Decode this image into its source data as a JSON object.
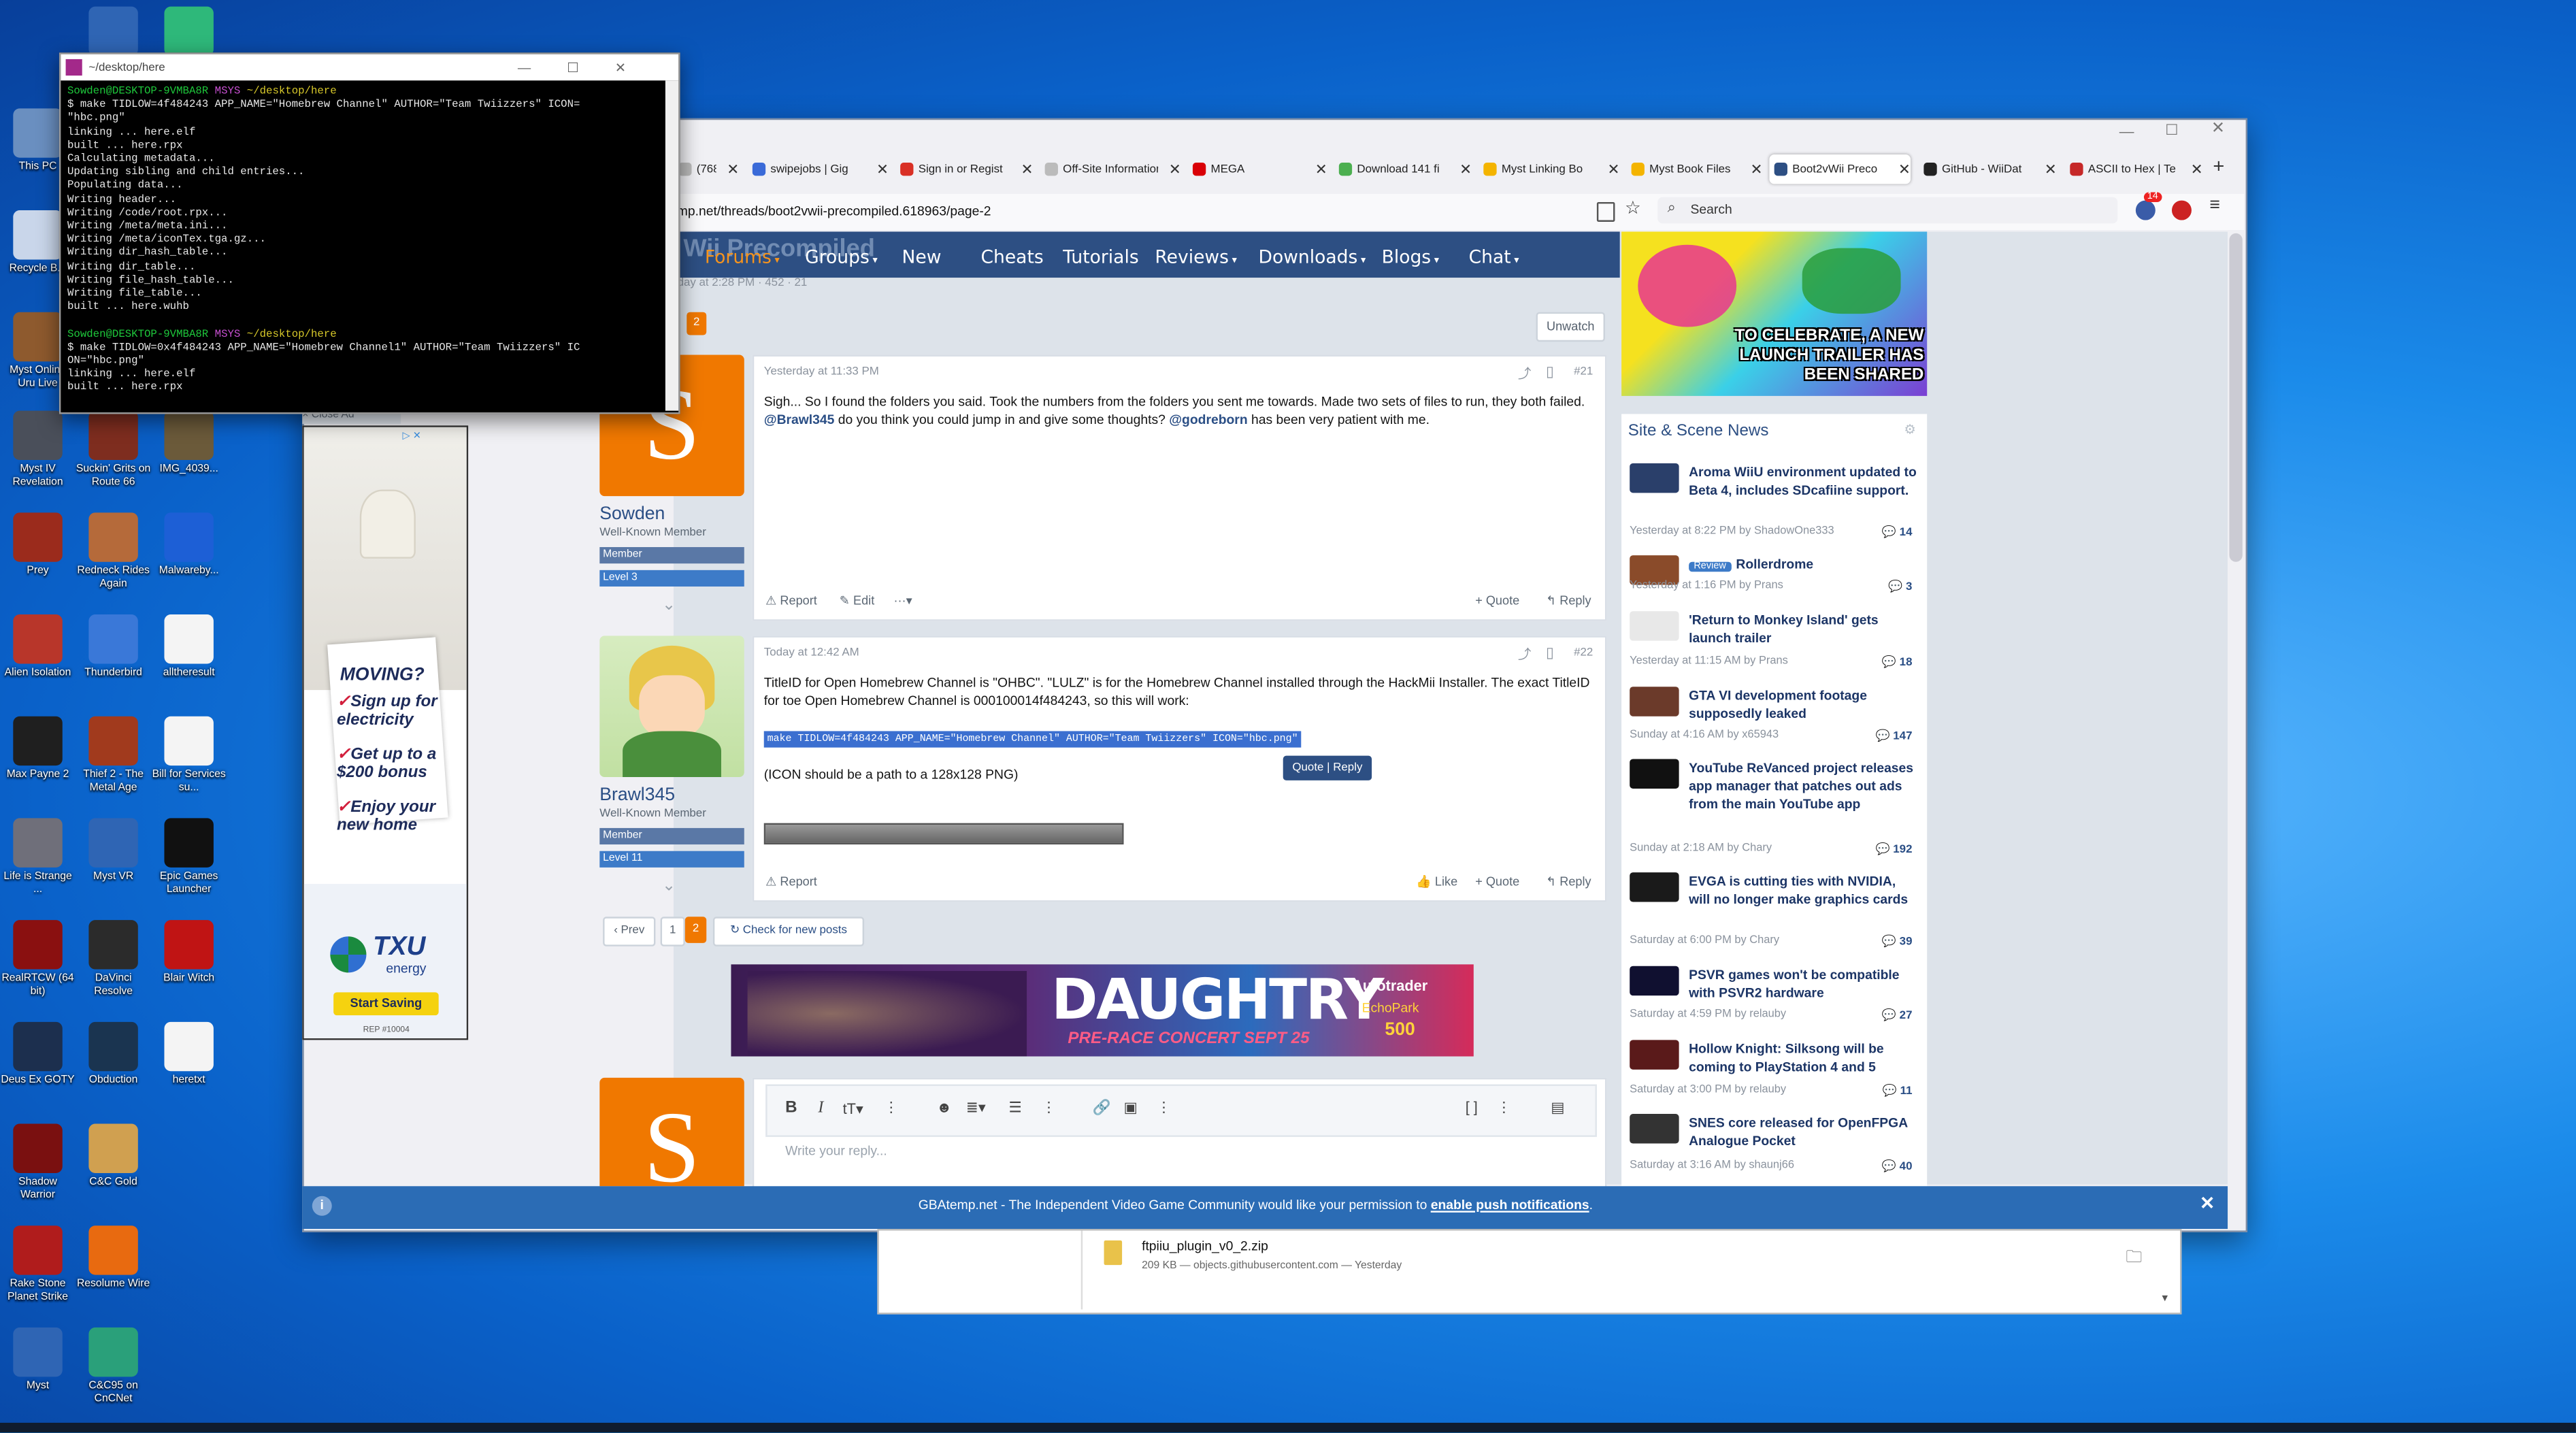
{
  "desktop": {
    "icons": [
      {
        "name": "myst-icon",
        "label": ""
      },
      {
        "name": "app-icon",
        "label": ""
      },
      {
        "name": "this-pc-icon",
        "label": "This PC"
      },
      {
        "name": "recycle-bin-icon",
        "label": "Recycle B..."
      },
      {
        "name": "myst-uru-icon",
        "label": "Myst Online Uru Live"
      },
      {
        "name": "myst-iv-icon",
        "label": "Myst IV Revelation"
      },
      {
        "name": "suckin-grits-icon",
        "label": "Suckin' Grits on Route 66"
      },
      {
        "name": "img-icon",
        "label": "IMG_4039..."
      },
      {
        "name": "prey-icon",
        "label": "Prey"
      },
      {
        "name": "redneck-rides-icon",
        "label": "Redneck Rides Again"
      },
      {
        "name": "malwarebytes-icon",
        "label": "Malwareby..."
      },
      {
        "name": "alien-isolation-icon",
        "label": "Alien Isolation"
      },
      {
        "name": "thunderbird-icon",
        "label": "Thunderbird"
      },
      {
        "name": "alltheresult-icon",
        "label": "alltheresult"
      },
      {
        "name": "max-payne-icon",
        "label": "Max Payne 2"
      },
      {
        "name": "thief-icon",
        "label": "Thief 2 - The Metal Age"
      },
      {
        "name": "bill-services-icon",
        "label": "Bill for Services su..."
      },
      {
        "name": "life-is-strange-icon",
        "label": "Life is Strange ..."
      },
      {
        "name": "myst-vr-icon",
        "label": "Myst VR"
      },
      {
        "name": "epic-games-icon",
        "label": "Epic Games Launcher"
      },
      {
        "name": "realrtcw-icon",
        "label": "RealRTCW (64 bit)"
      },
      {
        "name": "davinci-resolve-icon",
        "label": "DaVinci Resolve"
      },
      {
        "name": "blair-witch-icon",
        "label": "Blair Witch"
      },
      {
        "name": "deus-ex-icon",
        "label": "Deus Ex GOTY"
      },
      {
        "name": "obduction-icon",
        "label": "Obduction"
      },
      {
        "name": "heretxt-icon",
        "label": "heretxt"
      },
      {
        "name": "shadow-warrior-icon",
        "label": "Shadow Warrior"
      },
      {
        "name": "cnc-gold-icon",
        "label": "C&C Gold"
      },
      {
        "name": "rakestone-icon",
        "label": "Rake Stone Planet Strike"
      },
      {
        "name": "resolume-icon",
        "label": "Resolume Wire"
      },
      {
        "name": "myst-icon-2",
        "label": "Myst"
      },
      {
        "name": "cnc95-icon",
        "label": "C&C95 on CnCNet"
      }
    ]
  },
  "terminal": {
    "title": "~/desktop/here",
    "prompt1_user": "Sowden@DESKTOP-9VMBA8R",
    "prompt_env": "MSYS",
    "prompt_path": "~/desktop/here",
    "command1": "$ make TIDLOW=4f484243 APP_NAME=\"Homebrew Channel\" AUTHOR=\"Team Twiizzers\" ICON=\n\"hbc.png\"",
    "output1": "linking ... here.elf\nbuilt ... here.rpx\nCalculating metadata...\nUpdating sibling and child entries...\nPopulating data...\nWriting header...\nWriting /code/root.rpx...\nWriting /meta/meta.ini...\nWriting /meta/iconTex.tga.gz...\nWriting dir_hash_table...\nWriting dir_table...\nWriting file_hash_table...\nWriting file_table...\nbuilt ... here.wuhb",
    "command2": "$ make TIDLOW=0x4f484243 APP_NAME=\"Homebrew Channel1\" AUTHOR=\"Team Twiizzers\" IC\nON=\"hbc.png\"",
    "output2": "linking ... here.elf\nbuilt ... here.rpx"
  },
  "browser": {
    "tabs": [
      {
        "label": "(768)",
        "icon": "tab-icon"
      },
      {
        "label": "swipejobs | Gig",
        "icon": "swipejobs-icon"
      },
      {
        "label": "Sign in or Regist",
        "icon": "gmail-icon"
      },
      {
        "label": "Off-Site Information",
        "icon": "tab-icon"
      },
      {
        "label": "MEGA",
        "icon": "mega-icon"
      },
      {
        "label": "Download 141 fi",
        "icon": "download-icon"
      },
      {
        "label": "Myst Linking Bo",
        "icon": "drive-icon"
      },
      {
        "label": "Myst Book Files",
        "icon": "drive-icon"
      },
      {
        "label": "Boot2vWii Preco",
        "icon": "gbatemp-icon"
      },
      {
        "label": "GitHub - WiiDat",
        "icon": "github-icon"
      },
      {
        "label": "ASCII to Hex | Te",
        "icon": "rapidtables-icon"
      }
    ],
    "url": "mp.net/threads/boot2vwii-precompiled.618963/page-2",
    "search_placeholder": "Search",
    "notif_count": "14"
  },
  "site": {
    "menu": [
      "Forums",
      "Groups",
      "New",
      "Cheats",
      "Tutorials",
      "Reviews",
      "Downloads",
      "Blogs",
      "Chat"
    ],
    "thread_title_ghost": "Wii Precompiled",
    "thread_meta": "rday at 2:28 PM · 452 · 21",
    "page_current": "2",
    "unwatch": "Unwatch",
    "posts": [
      {
        "author": "Sowden",
        "role": "Well-Known Member",
        "badge": "Member",
        "level": "Level 3",
        "time": "Yesterday at 11:33 PM",
        "num": "#21",
        "text_a": "Sigh... So I found the folders you said. Took the numbers from the folders you sent me towards. Made two sets of files to run, they both failed. ",
        "mention1": "@Brawl345",
        "text_b": " do you think you could jump in and give some thoughts? ",
        "mention2": "@godreborn",
        "text_c": " has been very patient with me.",
        "report": "Report",
        "edit": "Edit",
        "quote": "Quote",
        "reply": "Reply"
      },
      {
        "author": "Brawl345",
        "role": "Well-Known Member",
        "badge": "Member",
        "level": "Level 11",
        "time": "Today at 12:42 AM",
        "num": "#22",
        "text": "TitleID for Open Homebrew Channel is \"OHBC\". \"LULZ\" is for the Homebrew Channel installed through the HackMii Installer. The exact TitleID for toe Open Homebrew Channel is 000100014f484243, so this will work:",
        "code": "make TIDLOW=4f484243 APP_NAME=\"Homebrew Channel\" AUTHOR=\"Team Twiizzers\" ICON=\"hbc.png\"",
        "note": "(ICON should be a path to a 128x128 PNG)",
        "tooltip": "Quote | Reply",
        "report": "Report",
        "like": "Like",
        "quote": "Quote",
        "reply": "Reply"
      }
    ],
    "pagination": {
      "prev": "‹ Prev",
      "p1": "1",
      "p2": "2",
      "check": "Check for new posts"
    },
    "ad_text": "DAUGHTRY",
    "ad_sub": "PRE-RACE CONCERT SEPT 25",
    "ad_brand": "Autotrader",
    "ad_brand2": "EchoPark",
    "ad_num": "500",
    "reply_placeholder": "Write your reply...",
    "promo_text": "TO CELEBRATE, A NEW LAUNCH TRAILER HAS BEEN SHARED",
    "news_header": "Site & Scene News",
    "news": [
      {
        "title": "Aroma WiiU environment updated to Beta 4, includes SDcafiine support.",
        "meta": "Yesterday at 8:22 PM by ShadowOne333",
        "count": "14",
        "tag": ""
      },
      {
        "title": "Rollerdrome",
        "meta": "Yesterday at 1:16 PM by Prans",
        "count": "3",
        "tag": "Review"
      },
      {
        "title": "'Return to Monkey Island' gets launch trailer",
        "meta": "Yesterday at 11:15 AM by Prans",
        "count": "18",
        "tag": ""
      },
      {
        "title": "GTA VI development footage supposedly leaked",
        "meta": "Sunday at 4:16 AM by x65943",
        "count": "147",
        "tag": ""
      },
      {
        "title": "YouTube ReVanced project releases app manager that patches out ads from the main YouTube app",
        "meta": "Sunday at 2:18 AM by Chary",
        "count": "192",
        "tag": ""
      },
      {
        "title": "EVGA is cutting ties with NVIDIA, will no longer make graphics cards",
        "meta": "Saturday at 6:00 PM by Chary",
        "count": "39",
        "tag": ""
      },
      {
        "title": "PSVR games won't be compatible with PSVR2 hardware",
        "meta": "Saturday at 4:59 PM by relauby",
        "count": "27",
        "tag": ""
      },
      {
        "title": "Hollow Knight: Silksong will be coming to PlayStation 4 and 5",
        "meta": "Saturday at 3:00 PM by relauby",
        "count": "11",
        "tag": ""
      },
      {
        "title": "SNES core released for OpenFPGA Analogue Pocket",
        "meta": "Saturday at 3:16 AM by shaunj66",
        "count": "40",
        "tag": ""
      }
    ],
    "side_ad": {
      "close": "× Close Ad",
      "moving": "MOVING?",
      "line1": "Sign up for electricity",
      "line2": "Get up to a $200 bonus",
      "line3": "Enjoy your new home",
      "brand": "TXU",
      "brand_sub": "energy",
      "cta": "Start Saving",
      "legal": "REP #10004"
    },
    "push_banner": {
      "text": "GBAtemp.net - The Independent Video Game Community would like your permission to ",
      "link": "enable push notifications",
      "end": "."
    }
  },
  "downloads": {
    "file": "ftpiiu_plugin_v0_2.zip",
    "meta": "209 KB — objects.githubusercontent.com — Yesterday"
  },
  "colors": {
    "accent": "#f07800",
    "site_nav": "#2d4f83",
    "banner": "#2b6cb5",
    "desktop": "#1683d8"
  }
}
